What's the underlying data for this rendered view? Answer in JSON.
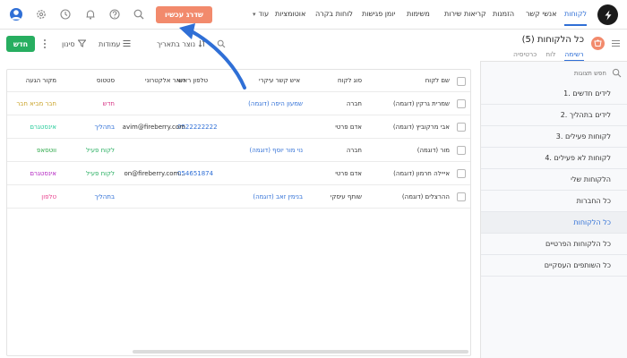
{
  "topbar": {
    "upgrade_label": "שדרג עכשיו",
    "more_label": "עוד",
    "nav": [
      {
        "label": "לקוחות",
        "active": true
      },
      {
        "label": "אנשי קשר",
        "active": false
      },
      {
        "label": "הזמנות",
        "active": false
      },
      {
        "label": "קריאות שירות",
        "active": false
      },
      {
        "label": "משימות",
        "active": false
      },
      {
        "label": "יומן פגישות",
        "active": false
      },
      {
        "label": "לוחות בקרה",
        "active": false
      },
      {
        "label": "אוטומציות",
        "active": false
      }
    ]
  },
  "page": {
    "title": "כל הלקוחות (5)",
    "view_tabs": [
      {
        "label": "רשימה",
        "active": true
      },
      {
        "label": "לוח",
        "active": false
      },
      {
        "label": "כרטיסיה",
        "active": false
      }
    ]
  },
  "toolbar": {
    "new_label": "חדש",
    "filter_label": "סינון",
    "columns_label": "עמודות",
    "sort_label": "נוצר בתאריך"
  },
  "sidebar": {
    "search_placeholder": "חפש תצוגות",
    "items": [
      {
        "label": "1. לידים חדשים",
        "active": false
      },
      {
        "label": "2. לידים בתהליך",
        "active": false
      },
      {
        "label": "3. לקוחות פעילים",
        "active": false
      },
      {
        "label": "4. לקוחות לא פעילים",
        "active": false
      },
      {
        "label": "הלקוחות שלי",
        "active": false
      },
      {
        "label": "כל החברות",
        "active": false
      },
      {
        "label": "כל הלקוחות",
        "active": true
      },
      {
        "label": "כל הלקוחות הפרטיים",
        "active": false
      },
      {
        "label": "כל השותפים העסקיים",
        "active": false
      }
    ]
  },
  "table": {
    "headers": [
      "שם לקוח",
      "סוג לקוח",
      "איש קשר עיקרי",
      "טלפון ראשי",
      "דואר אלקטרוני",
      "סטטוס",
      "מקור הגעה"
    ],
    "rows": [
      {
        "name": "שמרית גרקין (דוגמה)",
        "type": "חברה",
        "contact": "שמעון היפה (דוגמה)",
        "phone": "",
        "email": "",
        "status": "חדש",
        "source": "חבר מביא חבר"
      },
      {
        "name": "אבי מרקוביץ (דוגמה)",
        "type": "אדם פרטי",
        "contact": "",
        "phone": "0522222222",
        "email": "avim@fireberry.com",
        "status": "בתהליך",
        "source": "אינסטגרם"
      },
      {
        "name": "מור (דוגמה)",
        "type": "חברה",
        "contact": "נוי מור יוסף (דוגמה)",
        "phone": "",
        "email": "",
        "status": "לקוח פעיל",
        "source": "ווטסאפ"
      },
      {
        "name": "אייילה חרמון (דוגמה)",
        "type": "אדם פרטי",
        "contact": "",
        "phone": "054651874",
        "email": "on@fireberry.com...",
        "status": "לקוח פעיל",
        "source": "אינסטגרם"
      },
      {
        "name": "ההרצלים (דוגמה)",
        "type": "שותף עיסקי",
        "contact": "בנימין זאב (דוגמה)",
        "phone": "",
        "email": "",
        "status": "בתהליך",
        "source": "טלפון"
      }
    ]
  },
  "colors": {
    "accent": "#2f6fd6",
    "upgrade": "#f28a6c",
    "new": "#27ae60",
    "status_new": "#d63384",
    "status_progress": "#2f6fd6",
    "status_active": "#27ae60",
    "source_friend": "#c9a227",
    "source_instagram": "#20c997",
    "source_whatsapp": "#28a745",
    "source_phone": "#e83e8c"
  },
  "icons": [
    "logo-icon",
    "user-avatar-icon",
    "settings-icon",
    "clock-icon",
    "bell-icon",
    "help-icon",
    "search-icon",
    "filter-icon",
    "columns-icon",
    "sort-icon",
    "kebab-icon",
    "burger-icon",
    "customers-badge-icon"
  ]
}
